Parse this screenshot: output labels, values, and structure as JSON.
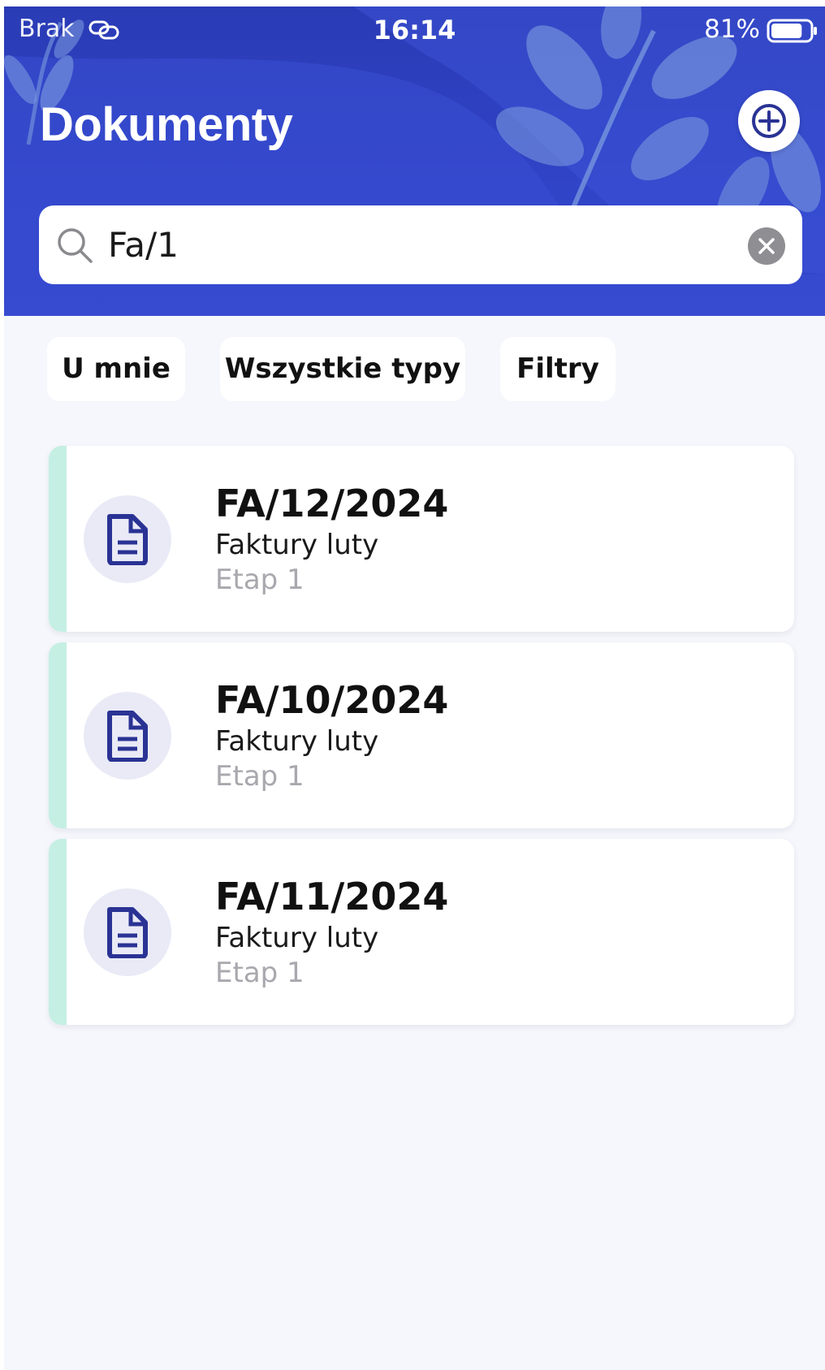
{
  "status_bar": {
    "carrier": "Brak",
    "time": "16:14",
    "battery": "81%",
    "battery_level": 0.81
  },
  "header": {
    "title": "Dokumenty",
    "add_icon": "plus-icon"
  },
  "search": {
    "value": "Fa/1",
    "placeholder": "",
    "icon": "search-icon",
    "clear_icon": "clear-icon"
  },
  "filters": [
    {
      "label": "U mnie"
    },
    {
      "label": "Wszystkie typy"
    },
    {
      "label": "Filtry"
    }
  ],
  "documents": [
    {
      "number": "FA/12/2024",
      "category": "Faktury luty",
      "stage": "Etap 1",
      "icon": "document-icon"
    },
    {
      "number": "FA/10/2024",
      "category": "Faktury luty",
      "stage": "Etap 1",
      "icon": "document-icon"
    },
    {
      "number": "FA/11/2024",
      "category": "Faktury luty",
      "stage": "Etap 1",
      "icon": "document-icon"
    }
  ],
  "colors": {
    "header_blue": "#3044c8",
    "accent_mint": "#c5efe3",
    "icon_navy": "#2a3394",
    "icon_circle": "#e9eaf6",
    "background": "#f6f7fc"
  }
}
